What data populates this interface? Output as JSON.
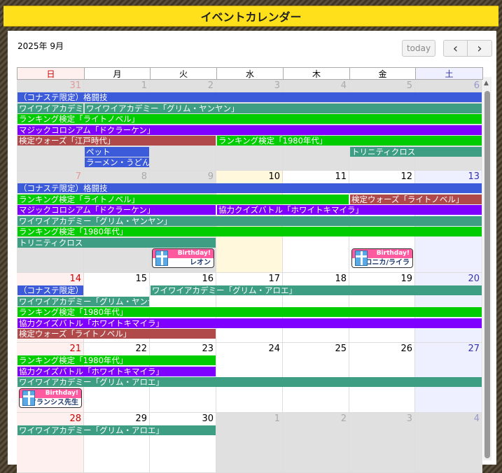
{
  "page": {
    "title": "イベントカレンダー"
  },
  "toolbar": {
    "month_title": "2025年 9月",
    "today_label": "today",
    "prev_icon": "‹",
    "next_icon": "›"
  },
  "weekdays": [
    "日",
    "月",
    "火",
    "水",
    "木",
    "金",
    "土"
  ],
  "weekday_colors": [
    "#cc0000",
    "#000",
    "#000",
    "#000",
    "#000",
    "#000",
    "#3333aa"
  ],
  "weeks": [
    {
      "days": [
        {
          "d": "31",
          "other": true
        },
        {
          "d": "1",
          "other": true
        },
        {
          "d": "2",
          "other": true
        },
        {
          "d": "3",
          "other": true
        },
        {
          "d": "4",
          "other": true
        },
        {
          "d": "5",
          "other": true
        },
        {
          "d": "6",
          "other": true
        }
      ]
    },
    {
      "days": [
        {
          "d": "7",
          "other": true
        },
        {
          "d": "8",
          "other": true
        },
        {
          "d": "9",
          "other": true
        },
        {
          "d": "10"
        },
        {
          "d": "11"
        },
        {
          "d": "12"
        },
        {
          "d": "13"
        }
      ]
    },
    {
      "days": [
        {
          "d": "14"
        },
        {
          "d": "15"
        },
        {
          "d": "16"
        },
        {
          "d": "17"
        },
        {
          "d": "18"
        },
        {
          "d": "19"
        },
        {
          "d": "20"
        }
      ]
    },
    {
      "days": [
        {
          "d": "21"
        },
        {
          "d": "22"
        },
        {
          "d": "23"
        },
        {
          "d": "24"
        },
        {
          "d": "25"
        },
        {
          "d": "26"
        },
        {
          "d": "27"
        }
      ]
    },
    {
      "days": [
        {
          "d": "28"
        },
        {
          "d": "29"
        },
        {
          "d": "30"
        },
        {
          "d": "1",
          "other": true
        },
        {
          "d": "2",
          "other": true
        },
        {
          "d": "3",
          "other": true
        },
        {
          "d": "4",
          "other": true
        }
      ]
    }
  ],
  "events": [
    {
      "week": 0,
      "row": 0,
      "start": 0,
      "end": 6,
      "title": "（コナステ限定）格闘技",
      "color": "#3b5bdb"
    },
    {
      "week": 0,
      "row": 1,
      "start": 0,
      "end": 0,
      "title": "ワイワイアカデミー「グリム・ヤンヤン」",
      "color": "#3d9e84"
    },
    {
      "week": 0,
      "row": 1,
      "start": 1,
      "end": 6,
      "title": "ワイワイアカデミー「グリム・ヤンヤン」",
      "color": "#3d9e84"
    },
    {
      "week": 0,
      "row": 2,
      "start": 0,
      "end": 6,
      "title": "ランキング検定「ライトノベル」",
      "color": "#00cc00"
    },
    {
      "week": 0,
      "row": 3,
      "start": 0,
      "end": 6,
      "title": "マジックコロシアム「ドクラーケン」",
      "color": "#7f00ff"
    },
    {
      "week": 0,
      "row": 4,
      "start": 0,
      "end": 2,
      "title": "検定ウォーズ「江戸時代」",
      "color": "#b04a4a"
    },
    {
      "week": 0,
      "row": 4,
      "start": 3,
      "end": 6,
      "title": "ランキング検定「1980年代」",
      "color": "#00cc00"
    },
    {
      "week": 0,
      "row": 5,
      "start": 1,
      "end": 1,
      "title": "ペット",
      "color": "#3b5bdb"
    },
    {
      "week": 0,
      "row": 5,
      "start": 5,
      "end": 6,
      "title": "トリニティクロス",
      "color": "#3d9e84"
    },
    {
      "week": 0,
      "row": 6,
      "start": 1,
      "end": 1,
      "title": "ラーメン・うどん",
      "color": "#3b5bdb"
    },
    {
      "week": 1,
      "row": 0,
      "start": 0,
      "end": 6,
      "title": "（コナステ限定）格闘技",
      "color": "#3b5bdb"
    },
    {
      "week": 1,
      "row": 1,
      "start": 0,
      "end": 4,
      "title": "ランキング検定「ライトノベル」",
      "color": "#00cc00"
    },
    {
      "week": 1,
      "row": 1,
      "start": 5,
      "end": 6,
      "title": "検定ウォーズ「ライトノベル」",
      "color": "#b04a4a"
    },
    {
      "week": 1,
      "row": 2,
      "start": 0,
      "end": 2,
      "title": "マジックコロシアム「ドクラーケン」",
      "color": "#7f00ff"
    },
    {
      "week": 1,
      "row": 2,
      "start": 3,
      "end": 6,
      "title": "協力クイズバトル「ホワイトキマイラ」",
      "color": "#7f00ff"
    },
    {
      "week": 1,
      "row": 3,
      "start": 0,
      "end": 6,
      "title": "ワイワイアカデミー「グリム・ヤンヤン」",
      "color": "#3d9e84"
    },
    {
      "week": 1,
      "row": 4,
      "start": 0,
      "end": 6,
      "title": "ランキング検定「1980年代」",
      "color": "#00cc00"
    },
    {
      "week": 1,
      "row": 5,
      "start": 0,
      "end": 2,
      "title": "トリニティクロス",
      "color": "#3d9e84"
    },
    {
      "week": 2,
      "row": 0,
      "start": 0,
      "end": 0,
      "title": "（コナステ限定）格闘技",
      "color": "#3b5bdb"
    },
    {
      "week": 2,
      "row": 0,
      "start": 2,
      "end": 6,
      "title": "ワイワイアカデミー「グリム・アロエ」",
      "color": "#3d9e84"
    },
    {
      "week": 2,
      "row": 1,
      "start": 0,
      "end": 1,
      "title": "ワイワイアカデミー「グリム・ヤンヤン」",
      "color": "#3d9e84"
    },
    {
      "week": 2,
      "row": 2,
      "start": 0,
      "end": 6,
      "title": "ランキング検定「1980年代」",
      "color": "#00cc00"
    },
    {
      "week": 2,
      "row": 3,
      "start": 0,
      "end": 6,
      "title": "協力クイズバトル「ホワイトキマイラ」",
      "color": "#7f00ff"
    },
    {
      "week": 2,
      "row": 4,
      "start": 0,
      "end": 2,
      "title": "検定ウォーズ「ライトノベル」",
      "color": "#b04a4a"
    },
    {
      "week": 3,
      "row": 0,
      "start": 0,
      "end": 2,
      "title": "ランキング検定「1980年代」",
      "color": "#00cc00"
    },
    {
      "week": 3,
      "row": 1,
      "start": 0,
      "end": 2,
      "title": "協力クイズバトル「ホワイトキマイラ」",
      "color": "#7f00ff"
    },
    {
      "week": 3,
      "row": 2,
      "start": 0,
      "end": 6,
      "title": "ワイワイアカデミー「グリム・アロエ」",
      "color": "#3d9e84"
    },
    {
      "week": 4,
      "row": 0,
      "start": 0,
      "end": 2,
      "title": "ワイワイアカデミー「グリム・アロエ」",
      "color": "#3d9e84"
    }
  ],
  "birthdays": [
    {
      "week": 1,
      "col": 2,
      "row": 6,
      "label": "Birthday!",
      "name": "レオン"
    },
    {
      "week": 1,
      "col": 5,
      "row": 6,
      "label": "Birthday!",
      "name": "クロニカ/ライラ"
    },
    {
      "week": 3,
      "col": 0,
      "row": 3,
      "label": "Birthday!",
      "name": "フランシス先生"
    }
  ]
}
